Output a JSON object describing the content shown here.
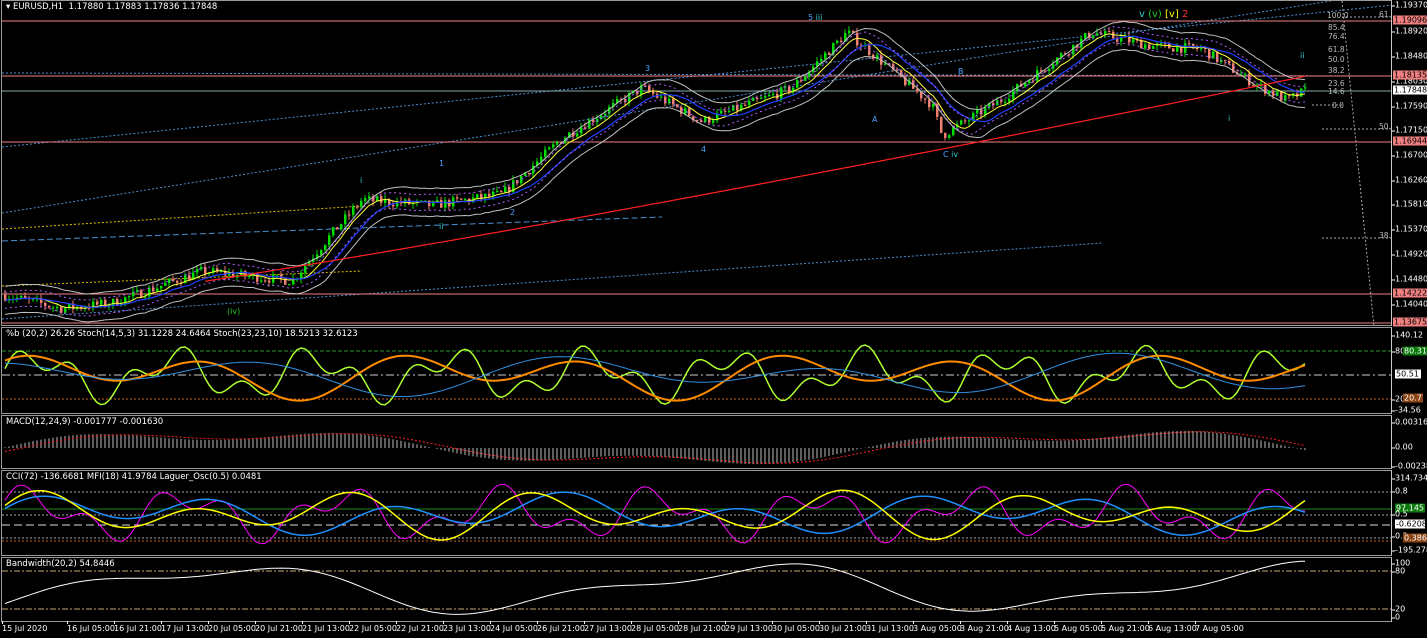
{
  "header": {
    "symbol": "EURUSD,H1",
    "ohlc": "1.17880 1.17883 1.17836 1.17848"
  },
  "main_axis": {
    "ticks": [
      "1.19370",
      "1.18920",
      "1.18480",
      "1.18030",
      "1.17590",
      "1.17150",
      "1.16700",
      "1.16260",
      "1.15810",
      "1.15370",
      "1.14920",
      "1.14480",
      "1.14040"
    ],
    "levels": [
      {
        "value": "1.19096",
        "color": "#f08080"
      },
      {
        "value": "1.18135",
        "color": "#f08080"
      },
      {
        "value": "1.17848",
        "color": "#ffffff"
      },
      {
        "value": "1.16944",
        "color": "#f08080"
      },
      {
        "value": "1.14222",
        "color": "#f08080"
      },
      {
        "value": "1.13675",
        "color": "#f08080"
      }
    ]
  },
  "fibs": [
    "100.0",
    "85.4",
    "76.4",
    "61.8",
    "50.0",
    "38.2",
    "23.6",
    "14.6",
    "0.0",
    "61.8",
    "50.0",
    "38.2"
  ],
  "wave_labels": [
    "5",
    "iii",
    "3",
    "1",
    "i",
    "ii",
    "2",
    "4",
    "(iv)",
    "A",
    "B",
    "C",
    "iv",
    "v",
    "(v)",
    "[v]",
    "2",
    "ii",
    "i"
  ],
  "stoch": {
    "title": "%b (20,2) 26.26  Stoch(14,5,3) 31.1228 24.6464  Stoch(23,23,10) 18.5213 32.6123",
    "ticks": [
      "140.12",
      "80",
      "50.51",
      "20",
      "-34.56"
    ],
    "tag_high": "80.31",
    "tag_mid": "50.51",
    "tag_low": "20.71"
  },
  "macd": {
    "title": "MACD(12,24,9) -0.001777 -0.001630",
    "ticks": [
      "0.003167",
      "0.00",
      "-0.002383"
    ]
  },
  "cci": {
    "title": "CCI(72) -136.6681  MFI(18) 41.9784  Laguer_Osc(0.5) 0.0481",
    "ticks": [
      "314.7345",
      "0.8",
      "0.5",
      "0.2",
      "-195.2787"
    ],
    "tag_green": "97.1451",
    "tag_white": "-0.6208",
    "tag_brown": "0.3867"
  },
  "bandwidth": {
    "title": "Bandwidth(20,2) 54.8446",
    "ticks": [
      "100",
      "80",
      "20",
      "0"
    ]
  },
  "time_axis": [
    "15 Jul 2020",
    "16 Jul 05:00",
    "16 Jul 21:00",
    "17 Jul 13:00",
    "20 Jul 05:00",
    "20 Jul 21:00",
    "21 Jul 13:00",
    "22 Jul 05:00",
    "22 Jul 21:00",
    "23 Jul 13:00",
    "24 Jul 05:00",
    "26 Jul 21:00",
    "27 Jul 13:00",
    "28 Jul 05:00",
    "28 Jul 21:00",
    "29 Jul 13:00",
    "30 Jul 05:00",
    "30 Jul 21:00",
    "31 Jul 13:00",
    "3 Aug 05:00",
    "3 Aug 21:00",
    "4 Aug 13:00",
    "5 Aug 05:00",
    "5 Aug 21:00",
    "6 Aug 13:00",
    "7 Aug 05:00"
  ],
  "colors": {
    "bull": "#00e000",
    "bear": "#f08070",
    "ma200": "#ff2020",
    "levels": "#f08080",
    "stoch_fast": "#adff2f",
    "stoch_slow": "#ff8c00",
    "cci": "#ff00ff",
    "mfi": "#ffff00",
    "laguerre": "#1e90ff"
  }
}
